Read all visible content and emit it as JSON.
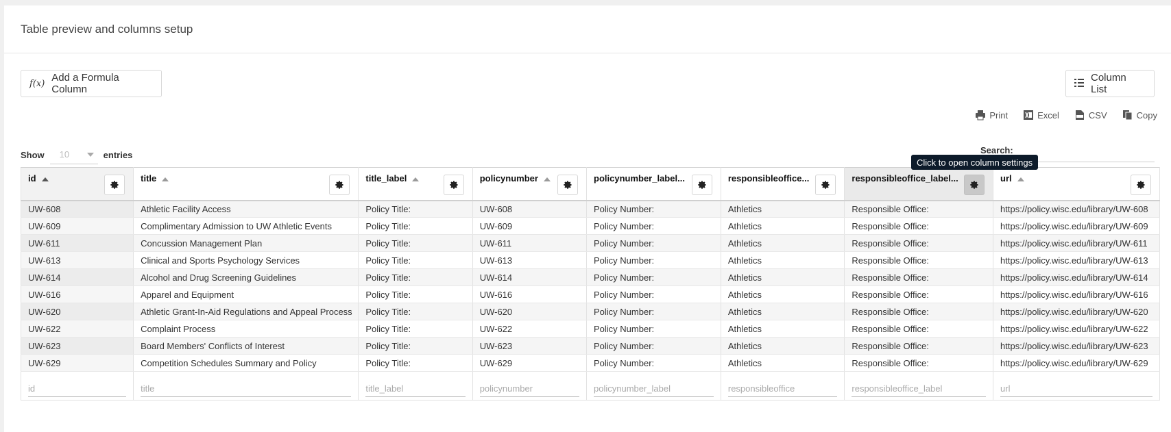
{
  "panel": {
    "title": "Table preview and columns setup"
  },
  "toolbar": {
    "formula_button": "Add a Formula Column",
    "formula_icon": "f(x)",
    "columns_button": "Column List"
  },
  "exports": [
    {
      "label": "Print",
      "icon": "print-icon"
    },
    {
      "label": "Excel",
      "icon": "excel-icon"
    },
    {
      "label": "CSV",
      "icon": "csv-icon"
    },
    {
      "label": "Copy",
      "icon": "copy-icon"
    }
  ],
  "length": {
    "show": "Show",
    "value": "10",
    "entries": "entries"
  },
  "search": {
    "label": "Search:"
  },
  "tooltip": "Click to open column settings",
  "columns": [
    {
      "label": "id",
      "sort": "asc-active",
      "filter": "id"
    },
    {
      "label": "title",
      "sort": "asc",
      "filter": "title"
    },
    {
      "label": "title_label",
      "sort": "asc",
      "filter": "title_label"
    },
    {
      "label": "policynumber",
      "sort": "asc",
      "filter": "policynumber"
    },
    {
      "label": "policynumber_label...",
      "sort": "",
      "filter": "policynumber_label"
    },
    {
      "label": "responsibleoffice...",
      "sort": "",
      "filter": "responsibleoffice"
    },
    {
      "label": "responsibleoffice_label...",
      "sort": "",
      "filter": "responsibleoffice_label"
    },
    {
      "label": "url",
      "sort": "asc",
      "filter": "url"
    }
  ],
  "rows": [
    [
      "UW-608",
      "Athletic Facility Access",
      "Policy Title:",
      "UW-608",
      "Policy Number:",
      "Athletics",
      "Responsible Office:",
      "https://policy.wisc.edu/library/UW-608"
    ],
    [
      "UW-609",
      "Complimentary Admission to UW Athletic Events",
      "Policy Title:",
      "UW-609",
      "Policy Number:",
      "Athletics",
      "Responsible Office:",
      "https://policy.wisc.edu/library/UW-609"
    ],
    [
      "UW-611",
      "Concussion Management Plan",
      "Policy Title:",
      "UW-611",
      "Policy Number:",
      "Athletics",
      "Responsible Office:",
      "https://policy.wisc.edu/library/UW-611"
    ],
    [
      "UW-613",
      "Clinical and Sports Psychology Services",
      "Policy Title:",
      "UW-613",
      "Policy Number:",
      "Athletics",
      "Responsible Office:",
      "https://policy.wisc.edu/library/UW-613"
    ],
    [
      "UW-614",
      "Alcohol and Drug Screening Guidelines",
      "Policy Title:",
      "UW-614",
      "Policy Number:",
      "Athletics",
      "Responsible Office:",
      "https://policy.wisc.edu/library/UW-614"
    ],
    [
      "UW-616",
      "Apparel and Equipment",
      "Policy Title:",
      "UW-616",
      "Policy Number:",
      "Athletics",
      "Responsible Office:",
      "https://policy.wisc.edu/library/UW-616"
    ],
    [
      "UW-620",
      "Athletic Grant-In-Aid Regulations and Appeal Process",
      "Policy Title:",
      "UW-620",
      "Policy Number:",
      "Athletics",
      "Responsible Office:",
      "https://policy.wisc.edu/library/UW-620"
    ],
    [
      "UW-622",
      "Complaint Process",
      "Policy Title:",
      "UW-622",
      "Policy Number:",
      "Athletics",
      "Responsible Office:",
      "https://policy.wisc.edu/library/UW-622"
    ],
    [
      "UW-623",
      "Board Members' Conflicts of Interest",
      "Policy Title:",
      "UW-623",
      "Policy Number:",
      "Athletics",
      "Responsible Office:",
      "https://policy.wisc.edu/library/UW-623"
    ],
    [
      "UW-629",
      "Competition Schedules Summary and Policy",
      "Policy Title:",
      "UW-629",
      "Policy Number:",
      "Athletics",
      "Responsible Office:",
      "https://policy.wisc.edu/library/UW-629"
    ]
  ],
  "colors": {
    "link": "#1a73d0",
    "tooltip_bg": "#0d1b2a"
  }
}
